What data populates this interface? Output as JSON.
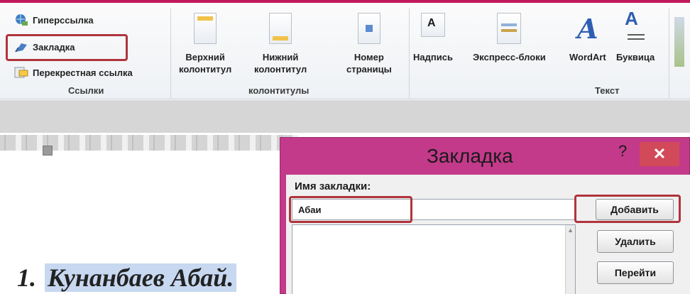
{
  "ribbon": {
    "links_group": {
      "label": "Ссылки",
      "items": [
        {
          "label": "Гиперссылка",
          "icon": "globe-link-icon"
        },
        {
          "label": "Закладка",
          "icon": "bookmark-flag-icon"
        },
        {
          "label": "Перекрестная ссылка",
          "icon": "cross-reference-icon"
        }
      ]
    },
    "header_footer_group": {
      "label": "колонтитулы",
      "buttons": [
        {
          "line1": "Верхний",
          "line2": "колонтитул",
          "icon": "header-page-icon"
        },
        {
          "line1": "Нижний",
          "line2": "колонтитул",
          "icon": "footer-page-icon"
        },
        {
          "line1": "Номер",
          "line2": "страницы",
          "icon": "page-number-icon"
        }
      ]
    },
    "text_group": {
      "label": "Текст",
      "buttons": [
        {
          "label": "Надпись",
          "icon": "text-box-icon"
        },
        {
          "label": "Экспресс-блоки",
          "icon": "quick-parts-icon"
        },
        {
          "label": "WordArt",
          "icon": "wordart-icon"
        },
        {
          "label": "Буквица",
          "icon": "drop-cap-icon"
        }
      ]
    }
  },
  "document": {
    "number": "1.",
    "text": "Кунанбаев Абай."
  },
  "dialog": {
    "title": "Закладка",
    "help": "?",
    "close": "✕",
    "name_label": "Имя закладки:",
    "name_value": "Абаи",
    "buttons": {
      "add": "Добавить",
      "delete": "Удалить",
      "goto": "Перейти"
    }
  },
  "colors": {
    "dialog_frame": "#c33a8a",
    "close_button": "#d24a5a",
    "highlight_box": "#b0343c",
    "text_selection": "#c7d8f0"
  }
}
